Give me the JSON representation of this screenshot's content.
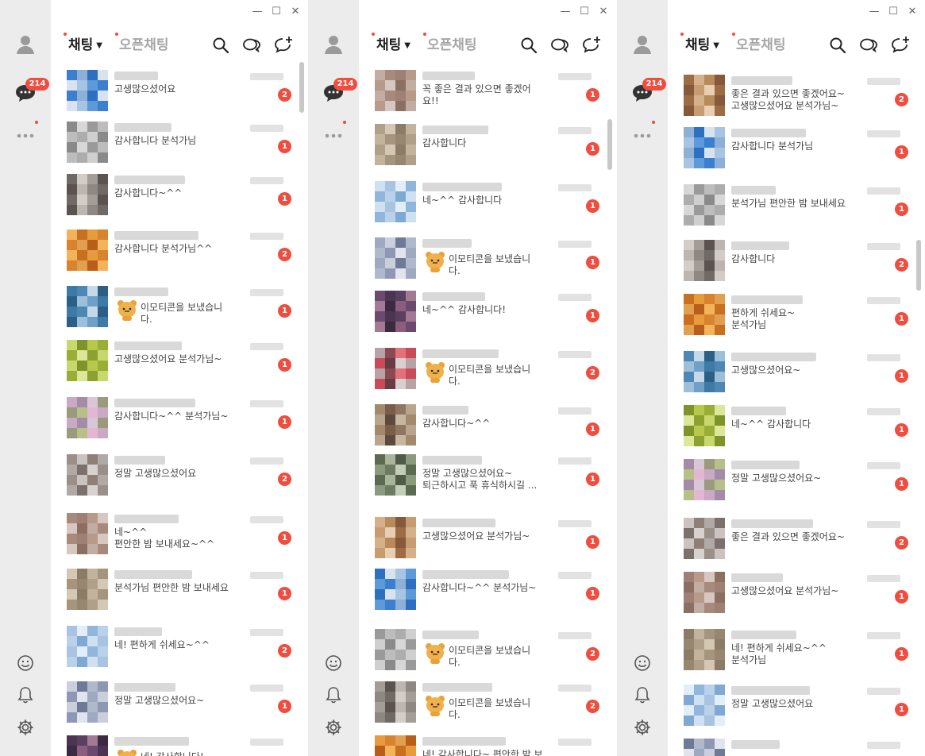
{
  "colors": {
    "accent": "#ee4d3f",
    "sidebar": "#ececed",
    "text": "#1e1e1e",
    "muted": "#a6a6a6"
  },
  "window_controls": [
    "—",
    "☐",
    "✕"
  ],
  "sidebar": {
    "unread_badge": "214",
    "icons": [
      "person-icon",
      "chat-bubble-icon",
      "more-icon",
      "emoji-icon",
      "bell-icon",
      "gear-icon"
    ]
  },
  "header": {
    "tab_chat": "채팅",
    "tab_open_chat": "오픈채팅",
    "icons": [
      "search-icon",
      "openchat-icon",
      "new-chat-icon"
    ]
  },
  "panels": [
    {
      "chats": [
        {
          "message": "고생많으셨어요",
          "unread": "2",
          "emoticon": false
        },
        {
          "message": "감사합니다 분석가님",
          "unread": "1",
          "emoticon": false
        },
        {
          "message": "감사합니다~^^",
          "unread": "1",
          "emoticon": false
        },
        {
          "message": "감사합니다 분석가님^^",
          "unread": "2",
          "emoticon": false
        },
        {
          "message": "이모티콘을 보냈습니\n다.",
          "unread": "1",
          "emoticon": true
        },
        {
          "message": "고생많으셨어요 분석가님~",
          "unread": "1",
          "emoticon": false
        },
        {
          "message": "감사합니다~^^ 분석가님~",
          "unread": "1",
          "emoticon": false
        },
        {
          "message": "정말 고생많으셨어요",
          "unread": "2",
          "emoticon": false
        },
        {
          "message": "네~^^\n편안한 밤 보내세요~^^",
          "unread": "1",
          "emoticon": false
        },
        {
          "message": "분석가님 편안한 밤 보내세요",
          "unread": "1",
          "emoticon": false
        },
        {
          "message": "네! 편하게 쉬세요~^^",
          "unread": "2",
          "emoticon": false
        },
        {
          "message": "정말 고생많으셨어요~",
          "unread": "1",
          "emoticon": false
        },
        {
          "message": "네! 감사합니다!",
          "unread": "",
          "emoticon": true
        }
      ]
    },
    {
      "chats": [
        {
          "message": "꼭 좋은 결과 있으면 좋겠어\n요!!",
          "unread": "1",
          "emoticon": false
        },
        {
          "message": "감사합니다",
          "unread": "1",
          "emoticon": false
        },
        {
          "message": "네~^^ 감사합니다",
          "unread": "1",
          "emoticon": false
        },
        {
          "message": "이모티콘을 보냈습니\n다.",
          "unread": "1",
          "emoticon": true
        },
        {
          "message": "네~^^ 감사합니다!",
          "unread": "1",
          "emoticon": false
        },
        {
          "message": "이모티콘을 보냈습니\n다.",
          "unread": "2",
          "emoticon": true
        },
        {
          "message": "감사합니다~^^",
          "unread": "1",
          "emoticon": false
        },
        {
          "message": "정말 고생많으셨어요~\n퇴근하시고 푹 휴식하시길 ...",
          "unread": "1",
          "emoticon": false
        },
        {
          "message": "고생많으셨어요 분석가님~",
          "unread": "1",
          "emoticon": false
        },
        {
          "message": "감사합니다~^^ 분석가님~",
          "unread": "1",
          "emoticon": false
        },
        {
          "message": "이모티콘을 보냈습니\n다.",
          "unread": "2",
          "emoticon": true
        },
        {
          "message": "이모티콘을 보냈습니\n다.",
          "unread": "2",
          "emoticon": true
        },
        {
          "message": "네! 감사합니다~ 편안한 밤 보",
          "unread": "",
          "emoticon": false
        }
      ]
    },
    {
      "chats": [
        {
          "message": "좋은 결과 있으면 좋겠어요~\n고생많으셨어요 분석가님~",
          "unread": "2",
          "emoticon": false
        },
        {
          "message": "감사합니다 분석가님",
          "unread": "1",
          "emoticon": false
        },
        {
          "message": "분석가님 편안한 밤 보내세요",
          "unread": "1",
          "emoticon": false
        },
        {
          "message": "감사합니다",
          "unread": "2",
          "emoticon": false
        },
        {
          "message": "편하게 쉬세요~\n분석가님",
          "unread": "1",
          "emoticon": false
        },
        {
          "message": "고생많으셨어요~",
          "unread": "1",
          "emoticon": false
        },
        {
          "message": "네~^^ 감사합니다",
          "unread": "1",
          "emoticon": false
        },
        {
          "message": "정말 고생많으셨어요~",
          "unread": "1",
          "emoticon": false
        },
        {
          "message": "좋은 결과 있으면 좋겠어요~",
          "unread": "2",
          "emoticon": false
        },
        {
          "message": "고생많으셨어요 분석가님~",
          "unread": "1",
          "emoticon": false
        },
        {
          "message": "네! 편하게 쉬세요~^^\n분석가님",
          "unread": "1",
          "emoticon": false
        },
        {
          "message": "정말 고생많으셨어요",
          "unread": "1",
          "emoticon": false
        },
        {
          "message": "",
          "unread": "",
          "emoticon": false
        }
      ]
    }
  ]
}
